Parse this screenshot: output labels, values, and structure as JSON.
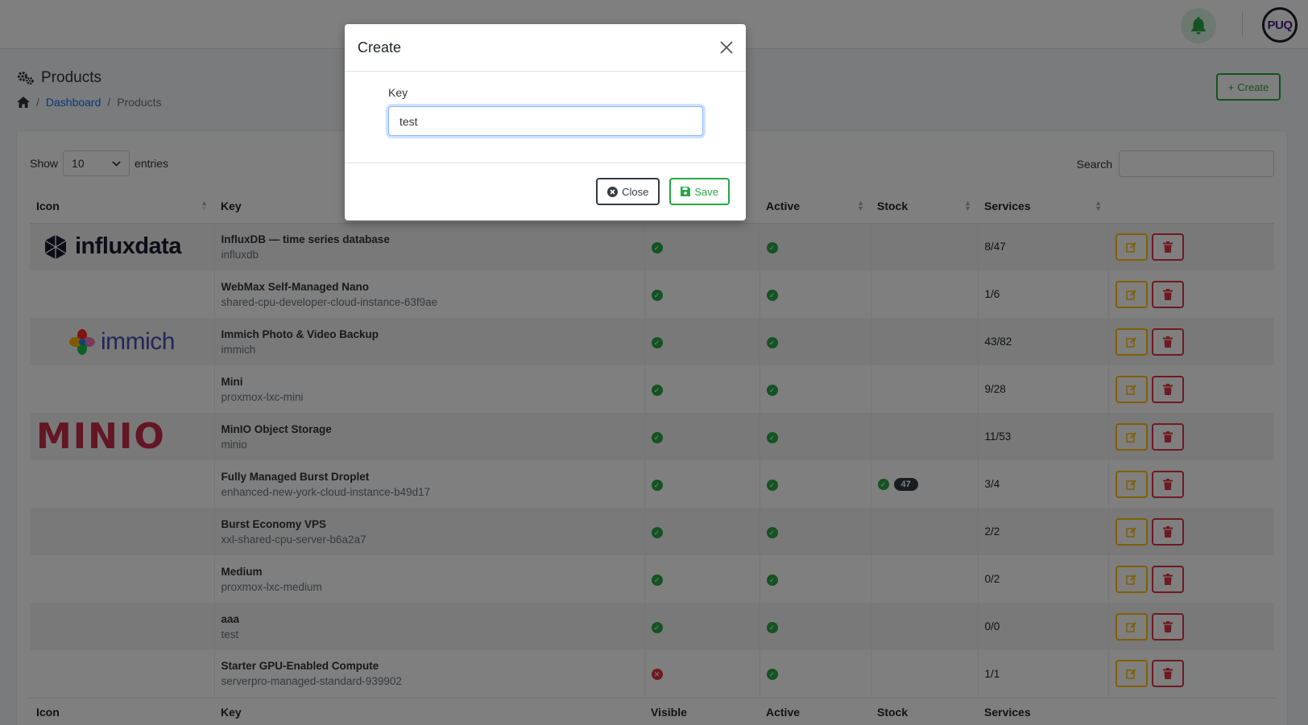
{
  "header": {
    "avatar_text": "PUQ"
  },
  "page": {
    "title": "Products",
    "breadcrumb": {
      "dashboard": "Dashboard",
      "current": "Products"
    },
    "create_label": "Create"
  },
  "table_controls": {
    "show_label": "Show",
    "page_size": "10",
    "entries_label": "entries",
    "search_label": "Search"
  },
  "columns": {
    "icon": "Icon",
    "key": "Key",
    "visible": "Visible",
    "active": "Active",
    "stock": "Stock",
    "services": "Services"
  },
  "logos": {
    "influx": "influxdata",
    "immich": "immich",
    "minio": "MINIO"
  },
  "rows": [
    {
      "name": "InfluxDB — time series database",
      "key": "influxdb",
      "services": "8/47"
    },
    {
      "name": "WebMax Self-Managed Nano",
      "key": "shared-cpu-developer-cloud-instance-63f9ae",
      "services": "1/6"
    },
    {
      "name": "Immich Photo & Video Backup",
      "key": "immich",
      "services": "43/82"
    },
    {
      "name": "Mini",
      "key": "proxmox-lxc-mini",
      "services": "9/28"
    },
    {
      "name": "MinIO Object Storage",
      "key": "minio",
      "services": "11/53"
    },
    {
      "name": "Fully Managed Burst Droplet",
      "key": "enhanced-new-york-cloud-instance-b49d17",
      "services": "3/4",
      "stock": "47"
    },
    {
      "name": "Burst Economy VPS",
      "key": "xxl-shared-cpu-server-b6a2a7",
      "services": "2/2"
    },
    {
      "name": "Medium",
      "key": "proxmox-lxc-medium",
      "services": "0/2"
    },
    {
      "name": "aaa",
      "key": "test",
      "services": "0/0"
    },
    {
      "name": "Starter GPU-Enabled Compute",
      "key": "serverpro-managed-standard-939902",
      "services": "1/1"
    }
  ],
  "modal": {
    "title": "Create",
    "key_label": "Key",
    "key_value": "test",
    "close_label": "Close",
    "save_label": "Save"
  }
}
